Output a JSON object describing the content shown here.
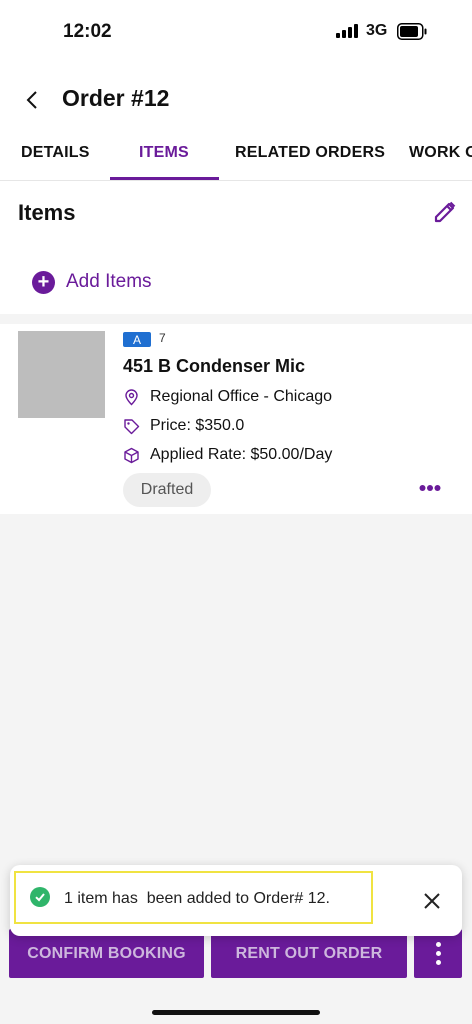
{
  "status_bar": {
    "time": "12:02",
    "network": "3G"
  },
  "header": {
    "title": "Order #12"
  },
  "tabs": [
    {
      "label": "DETAILS"
    },
    {
      "label": "ITEMS",
      "active": true
    },
    {
      "label": "RELATED ORDERS"
    },
    {
      "label": "WORK O"
    }
  ],
  "items_section": {
    "title": "Items",
    "add_label": "Add Items"
  },
  "item": {
    "badge": "A",
    "quantity": "7",
    "name": "451 B Condenser Mic",
    "location": "Regional Office - Chicago",
    "price": "Price: $350.0",
    "rate": "Applied Rate: $50.00/Day",
    "status": "Drafted"
  },
  "actions": {
    "confirm": "CONFIRM BOOKING",
    "rent_out": "RENT OUT ORDER"
  },
  "toast": {
    "message": "1 item has  been added to Order# 12."
  },
  "colors": {
    "accent": "#6a1b9a",
    "badge": "#1f6fd1",
    "success": "#2fb56a",
    "highlight": "#f0e341"
  },
  "icons": [
    "back-icon",
    "edit-icon",
    "plus-icon",
    "location-icon",
    "tag-icon",
    "box-icon",
    "more-horizontal-icon",
    "more-vertical-icon",
    "check-circle-icon",
    "close-icon"
  ]
}
